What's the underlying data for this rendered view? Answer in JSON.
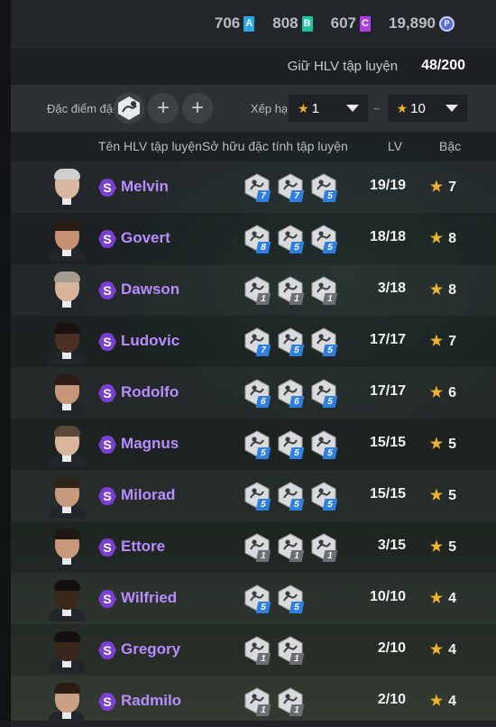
{
  "currency": [
    {
      "value": "706",
      "tag": "A",
      "color": "#27a9e8"
    },
    {
      "value": "808",
      "tag": "B",
      "color": "#1cc3a0"
    },
    {
      "value": "607",
      "tag": "C",
      "color": "#b13ee0"
    },
    {
      "value": "19,890",
      "tag": "coin",
      "color": "#5a6fd8"
    }
  ],
  "trainer_count": {
    "label": "Giữ HLV tập luyện",
    "value": "48/200"
  },
  "filter": {
    "trait_label": "Đặc điểm đặc tính",
    "rank_label": "Xếp hạng",
    "rank_from": "1",
    "rank_to": "10",
    "tilde": "~",
    "plus": "+"
  },
  "headers": {
    "name": "Tên HLV tập luyện",
    "traits": "Sở hữu đặc tính tập luyện",
    "lv": "LV",
    "tier": "Bậc"
  },
  "rows": [
    {
      "name": "Melvin",
      "lv": "19/19",
      "tier": "7",
      "traits": [
        {
          "icon": "shooting-icon",
          "lv": "7",
          "color": "blue"
        },
        {
          "icon": "dribble-icon",
          "lv": "7",
          "color": "blue"
        },
        {
          "icon": "stamina-icon",
          "lv": "5",
          "color": "blue"
        }
      ]
    },
    {
      "name": "Govert",
      "lv": "18/18",
      "tier": "8",
      "traits": [
        {
          "icon": "tackle-icon",
          "lv": "8",
          "color": "blue"
        },
        {
          "icon": "stamina-icon",
          "lv": "5",
          "color": "blue"
        },
        {
          "icon": "running-icon",
          "lv": "5",
          "color": "blue"
        }
      ]
    },
    {
      "name": "Dawson",
      "lv": "3/18",
      "tier": "8",
      "traits": [
        {
          "icon": "shooting-icon",
          "lv": "1",
          "color": "gray"
        },
        {
          "icon": "stamina-icon",
          "lv": "1",
          "color": "gray"
        },
        {
          "icon": "running-icon",
          "lv": "1",
          "color": "gray"
        }
      ]
    },
    {
      "name": "Ludovic",
      "lv": "17/17",
      "tier": "7",
      "traits": [
        {
          "icon": "goal-icon",
          "lv": "7",
          "color": "blue"
        },
        {
          "icon": "stamina-icon",
          "lv": "5",
          "color": "blue"
        },
        {
          "icon": "header-icon",
          "lv": "5",
          "color": "blue"
        }
      ]
    },
    {
      "name": "Rodolfo",
      "lv": "17/17",
      "tier": "6",
      "traits": [
        {
          "icon": "tactics-icon",
          "lv": "6",
          "color": "blue"
        },
        {
          "icon": "goal-icon",
          "lv": "6",
          "color": "blue"
        },
        {
          "icon": "stamina-icon",
          "lv": "5",
          "color": "blue"
        }
      ]
    },
    {
      "name": "Magnus",
      "lv": "15/15",
      "tier": "5",
      "traits": [
        {
          "icon": "strength-icon",
          "lv": "5",
          "color": "blue"
        },
        {
          "icon": "stamina-icon",
          "lv": "5",
          "color": "blue"
        },
        {
          "icon": "defend-icon",
          "lv": "5",
          "color": "blue"
        }
      ]
    },
    {
      "name": "Milorad",
      "lv": "15/15",
      "tier": "5",
      "traits": [
        {
          "icon": "tactics-icon",
          "lv": "5",
          "color": "blue"
        },
        {
          "icon": "trophy-icon",
          "lv": "5",
          "color": "blue"
        },
        {
          "icon": "stamina-icon",
          "lv": "5",
          "color": "blue"
        }
      ]
    },
    {
      "name": "Ettore",
      "lv": "3/15",
      "tier": "5",
      "traits": [
        {
          "icon": "strength-icon",
          "lv": "1",
          "color": "gray"
        },
        {
          "icon": "stamina-icon",
          "lv": "1",
          "color": "gray"
        },
        {
          "icon": "defend-icon",
          "lv": "1",
          "color": "gray"
        }
      ]
    },
    {
      "name": "Wilfried",
      "lv": "10/10",
      "tier": "4",
      "traits": [
        {
          "icon": "strength-icon",
          "lv": "5",
          "color": "blue"
        },
        {
          "icon": "stamina-icon",
          "lv": "5",
          "color": "blue"
        }
      ]
    },
    {
      "name": "Gregory",
      "lv": "2/10",
      "tier": "4",
      "traits": [
        {
          "icon": "strength-icon",
          "lv": "1",
          "color": "gray"
        },
        {
          "icon": "stamina-icon",
          "lv": "1",
          "color": "gray"
        }
      ]
    },
    {
      "name": "Radmilo",
      "lv": "2/10",
      "tier": "4",
      "traits": [
        {
          "icon": "strength-icon",
          "lv": "1",
          "color": "gray"
        },
        {
          "icon": "stamina-icon",
          "lv": "1",
          "color": "gray"
        }
      ]
    }
  ],
  "colors": {
    "blue_badge": "#2f7fe0",
    "gray_badge": "#6b6f74",
    "name": "#b98cff",
    "star": "#f0b229",
    "badge_purple": "#7b3fd6"
  }
}
